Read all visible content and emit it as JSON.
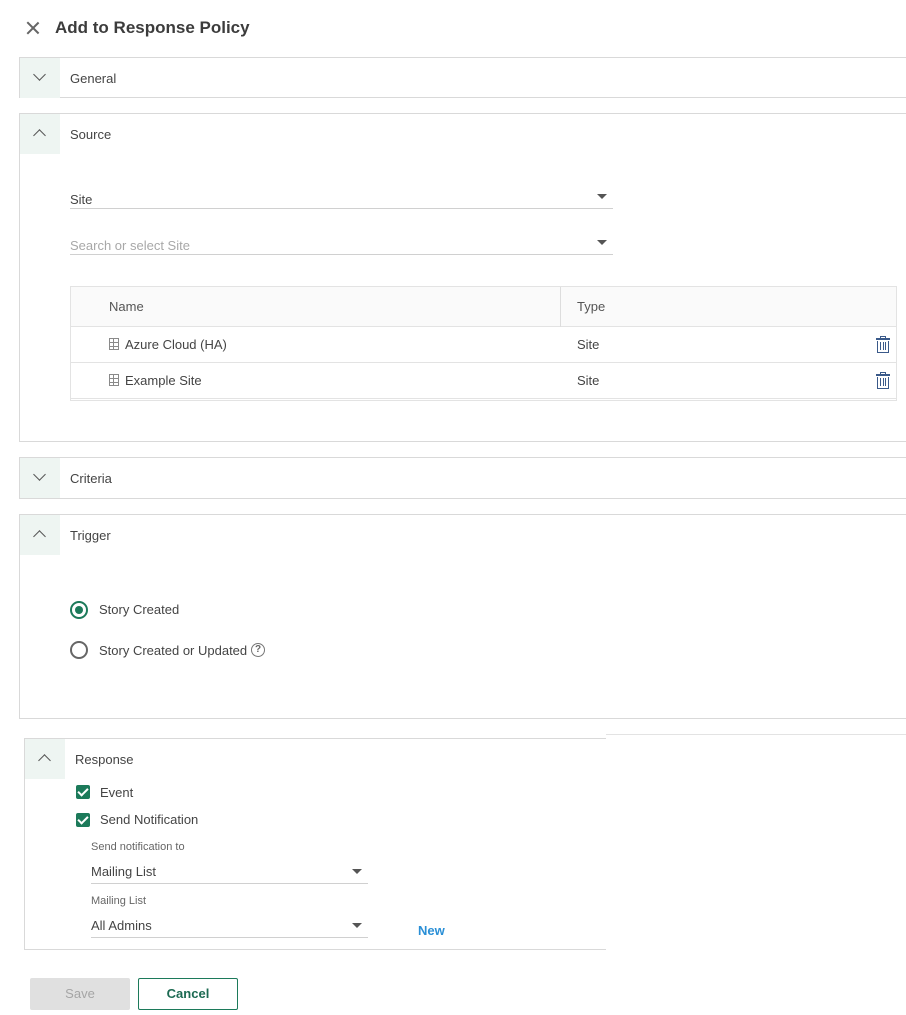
{
  "header": {
    "title": "Add to Response Policy",
    "close_icon": "close-icon"
  },
  "sections": {
    "general": {
      "title": "General",
      "expanded": false
    },
    "source": {
      "title": "Source",
      "expanded": true,
      "type_select": {
        "value": "Site"
      },
      "site_select": {
        "placeholder": "Search or select Site"
      },
      "table": {
        "columns": [
          "Name",
          "Type"
        ],
        "rows": [
          {
            "name": "Azure Cloud (HA)",
            "type": "Site"
          },
          {
            "name": "Example Site",
            "type": "Site"
          }
        ]
      }
    },
    "criteria": {
      "title": "Criteria",
      "expanded": false
    },
    "trigger": {
      "title": "Trigger",
      "expanded": true,
      "options": [
        {
          "label": "Story Created",
          "selected": true
        },
        {
          "label": "Story Created or Updated",
          "selected": false,
          "help": "?"
        }
      ]
    },
    "response": {
      "title": "Response",
      "expanded": true,
      "checks": [
        {
          "label": "Event",
          "checked": true
        },
        {
          "label": "Send Notification",
          "checked": true
        }
      ],
      "notify_to": {
        "label": "Send notification to",
        "value": "Mailing List"
      },
      "mailing_list": {
        "label": "Mailing List",
        "value": "All Admins"
      },
      "new_link": "New"
    }
  },
  "footer": {
    "save_label": "Save",
    "cancel_label": "Cancel"
  },
  "colors": {
    "accent": "#1c7a5a",
    "link": "#2a8fd6",
    "trash": "#3a5a8a"
  }
}
